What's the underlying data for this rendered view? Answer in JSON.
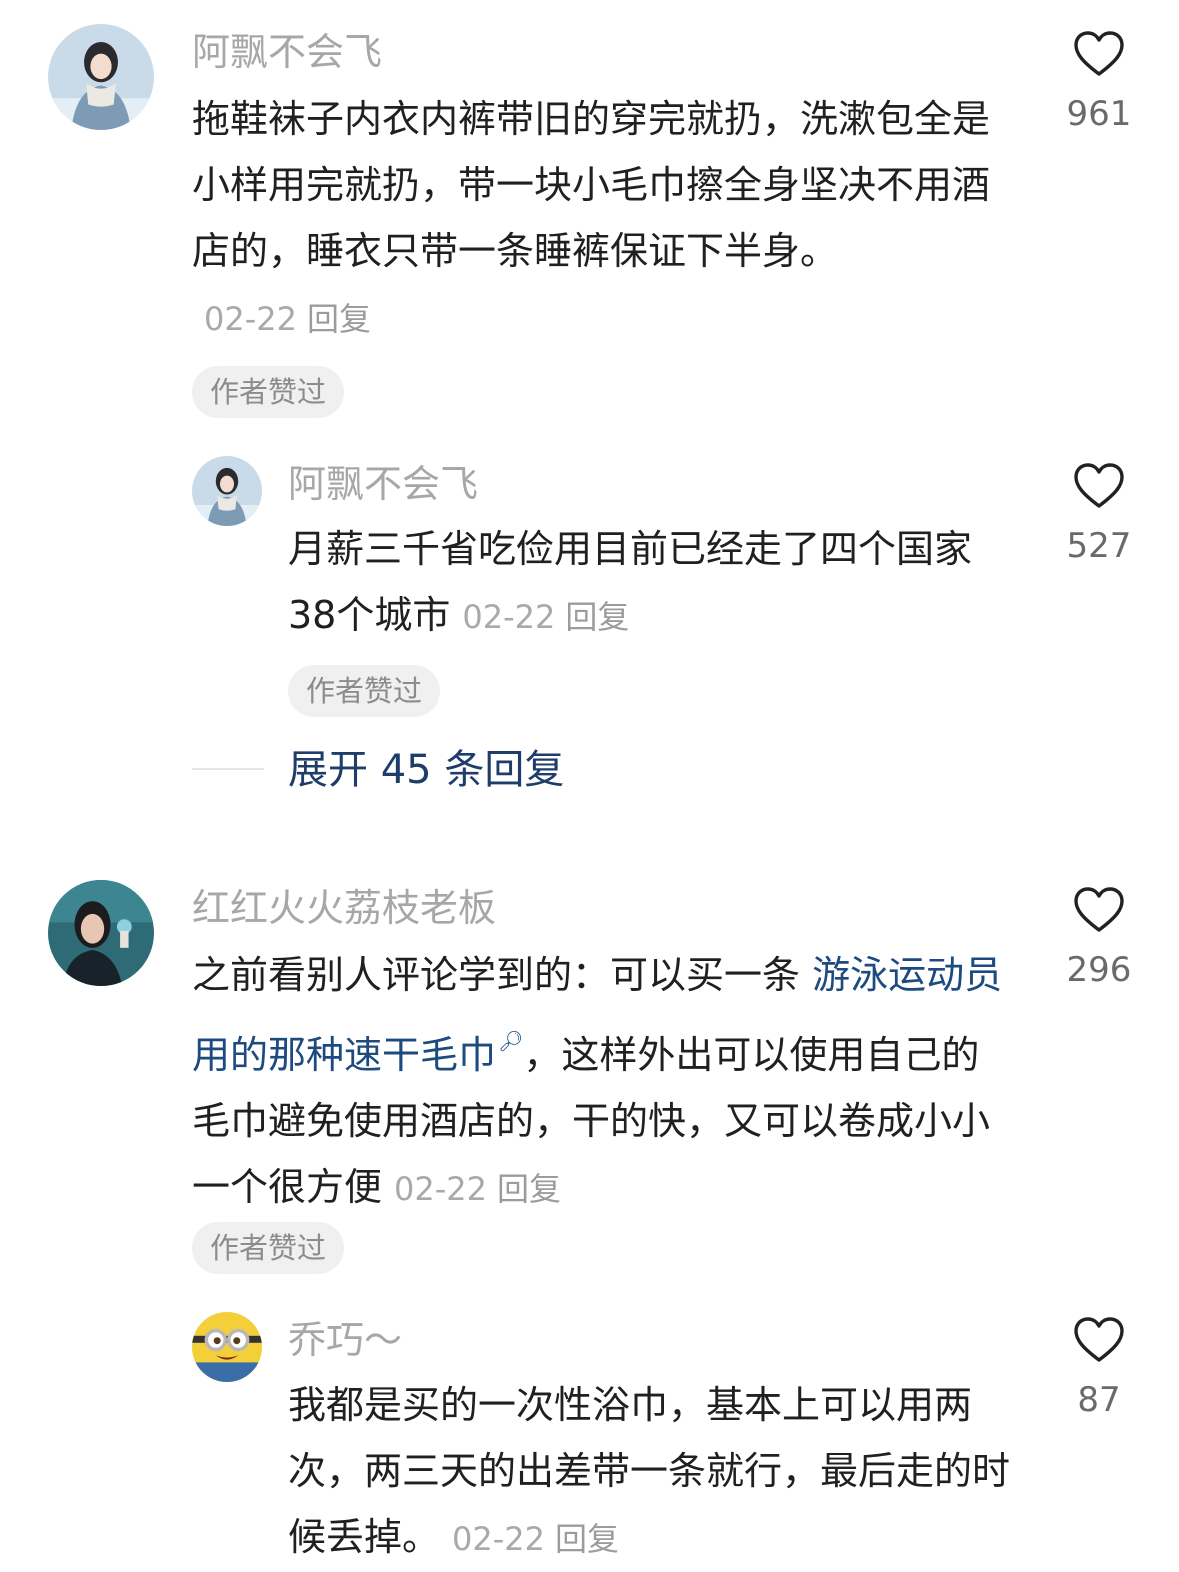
{
  "comments": [
    {
      "username": "阿飘不会飞",
      "text": "拖鞋袜子内衣内裤带旧的穿完就扔，洗漱包全是小样用完就扔，带一块小毛巾擦全身坚决不用酒店的，睡衣只带一条睡裤保证下半身。",
      "date": "02-22",
      "reply": "回复",
      "badge": "作者赞过",
      "likes": "961",
      "avatar_icon": "avatar-girl-scarf-icon"
    },
    {
      "username": "阿飘不会飞",
      "text": "月薪三千省吃俭用目前已经走了四个国家 38个城市",
      "date": "02-22",
      "reply": "回复",
      "badge": "作者赞过",
      "likes": "527",
      "avatar_icon": "avatar-girl-scarf-icon"
    },
    {
      "username": "红红火火荔枝老板",
      "text_before": "之前看别人评论学到的：可以买一条 ",
      "text_link": "游泳运动员用的那种速干毛巾",
      "text_after": "，这样外出可以使用自己的毛巾避免使用酒店的，干的快，又可以卷成小小一个很方便",
      "date": "02-22",
      "reply": "回复",
      "badge": "作者赞过",
      "likes": "296",
      "avatar_icon": "avatar-woman-photo-icon"
    },
    {
      "username": "乔巧～",
      "text": "我都是买的一次性浴巾，基本上可以用两次，两三天的出差带一条就行，最后走的时候丢掉。",
      "date": "02-22",
      "reply": "回复",
      "likes": "87",
      "avatar_icon": "avatar-minion-icon"
    }
  ],
  "expand_replies": "展开 45 条回复",
  "colors": {
    "username": "#a7a7a7",
    "text": "#202020",
    "link": "#1d4a7f",
    "expand": "#1f3d6b",
    "badge_bg": "#f0f0f0"
  }
}
